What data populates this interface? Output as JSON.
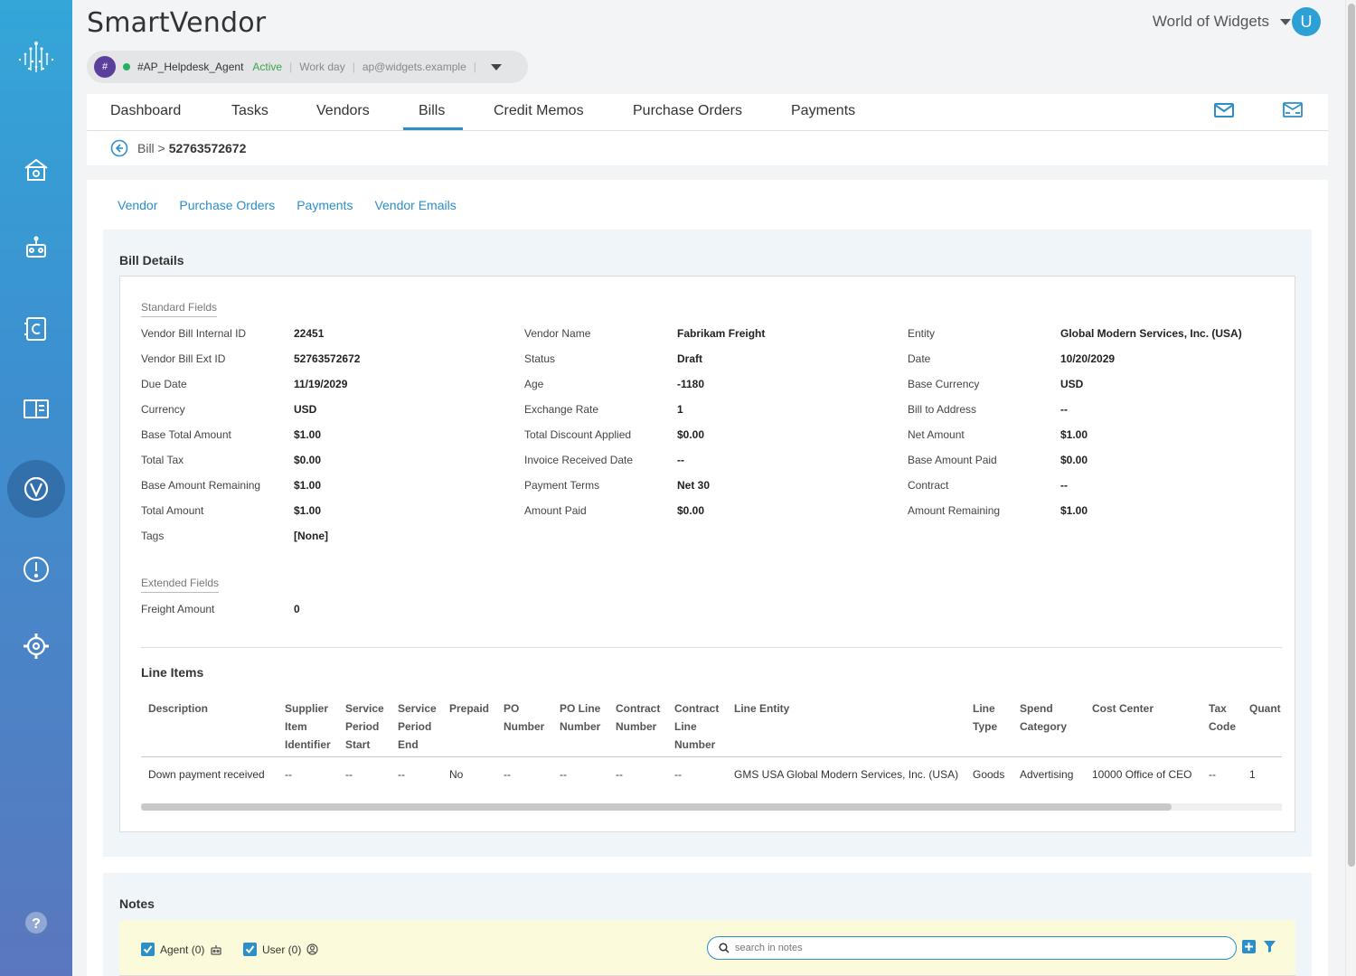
{
  "app": {
    "title": "SmartVendor",
    "org": "World of Widgets",
    "avatar_initial": "U"
  },
  "agent": {
    "hash": "#",
    "name": "#AP_Helpdesk_Agent",
    "status": "Active",
    "schedule": "Work day",
    "email": "ap@widgets.example",
    "sep": "|"
  },
  "tabs": [
    {
      "label": "Dashboard"
    },
    {
      "label": "Tasks"
    },
    {
      "label": "Vendors"
    },
    {
      "label": "Bills"
    },
    {
      "label": "Credit Memos"
    },
    {
      "label": "Purchase Orders"
    },
    {
      "label": "Payments"
    }
  ],
  "active_tab": "Bills",
  "breadcrumb": {
    "root": "Bill >",
    "id": "52763572672"
  },
  "subtabs": [
    {
      "label": "Vendor"
    },
    {
      "label": "Purchase Orders"
    },
    {
      "label": "Payments"
    },
    {
      "label": "Vendor Emails"
    }
  ],
  "bill_details": {
    "title": "Bill Details",
    "standard_label": "Standard Fields",
    "col1": [
      {
        "label": "Vendor Bill Internal ID",
        "value": "22451"
      },
      {
        "label": "Vendor Bill Ext ID",
        "value": "52763572672"
      },
      {
        "label": "Due Date",
        "value": "11/19/2029"
      },
      {
        "label": "Currency",
        "value": "USD"
      },
      {
        "label": "Base Total Amount",
        "value": "$1.00"
      },
      {
        "label": "Total Tax",
        "value": "$0.00"
      },
      {
        "label": "Base Amount Remaining",
        "value": "$1.00"
      },
      {
        "label": "Total Amount",
        "value": "$1.00"
      },
      {
        "label": "Tags",
        "value": "[None]"
      }
    ],
    "col2": [
      {
        "label": "Vendor Name",
        "value": "Fabrikam Freight"
      },
      {
        "label": "Status",
        "value": "Draft"
      },
      {
        "label": "Age",
        "value": "-1180"
      },
      {
        "label": "Exchange Rate",
        "value": "1"
      },
      {
        "label": "Total Discount Applied",
        "value": "$0.00"
      },
      {
        "label": "Invoice Received Date",
        "value": "--"
      },
      {
        "label": "Payment Terms",
        "value": "Net 30"
      },
      {
        "label": "Amount Paid",
        "value": "$0.00"
      }
    ],
    "col3": [
      {
        "label": "Entity",
        "value": "Global Modern Services, Inc. (USA)"
      },
      {
        "label": "Date",
        "value": "10/20/2029"
      },
      {
        "label": "Base Currency",
        "value": "USD"
      },
      {
        "label": "Bill to Address",
        "value": "--"
      },
      {
        "label": "Net Amount",
        "value": "$1.00"
      },
      {
        "label": "Base Amount Paid",
        "value": "$0.00"
      },
      {
        "label": "Contract",
        "value": "--"
      },
      {
        "label": "Amount Remaining",
        "value": "$1.00"
      }
    ],
    "extended_label": "Extended Fields",
    "extended": [
      {
        "label": "Freight Amount",
        "value": "0"
      }
    ]
  },
  "line_items": {
    "title": "Line Items",
    "headers": [
      "Description",
      "Supplier Item Identifier",
      "Service Period Start",
      "Service Period End",
      "Prepaid",
      "PO Number",
      "PO Line Number",
      "Contract Number",
      "Contract Line Number",
      "Line Entity",
      "Line Type",
      "Spend Category",
      "Cost Center",
      "Tax Code",
      "Quant"
    ],
    "rows": [
      [
        "Down payment received",
        "--",
        "--",
        "--",
        "No",
        "--",
        "--",
        "--",
        "--",
        "GMS USA Global Modern Services, Inc. (USA)",
        "Goods",
        "Advertising",
        "10000 Office of CEO",
        "--",
        "1"
      ]
    ]
  },
  "notes": {
    "title": "Notes",
    "agent_filter": "Agent (0)",
    "user_filter": "User (0)",
    "search_placeholder": "search in notes"
  },
  "colors": {
    "accent": "#2d8fc7",
    "active_green": "#3aa34a",
    "agent_purple": "#5b3f9c"
  }
}
